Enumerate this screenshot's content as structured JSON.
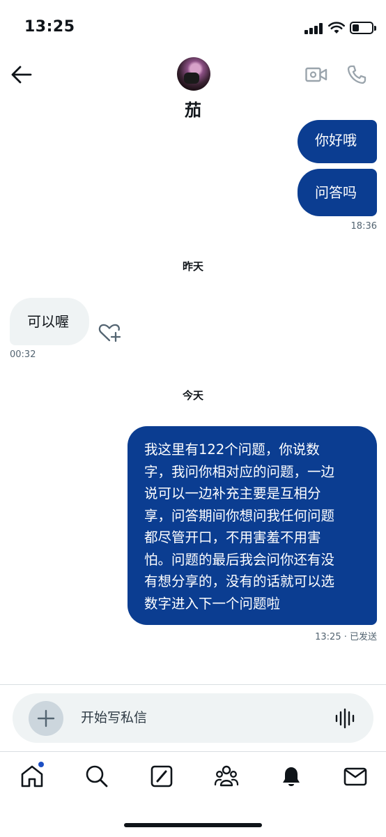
{
  "status_bar": {
    "time": "13:25"
  },
  "header": {
    "contact_name": "茄"
  },
  "messages": [
    {
      "direction": "sent",
      "text": "你好哦"
    },
    {
      "direction": "sent",
      "text": "问答吗",
      "timestamp": "18:36"
    },
    {
      "separator": "昨天"
    },
    {
      "direction": "received",
      "text": "可以喔",
      "timestamp": "00:32"
    },
    {
      "separator": "今天"
    },
    {
      "direction": "sent",
      "lines": [
        "我这里有122个问题，你说数",
        "字，我问你相对应的问题，一边",
        "说可以一边补充主要是互相分",
        "享，问答期间你想问我任何问题",
        "都尽管开口，不用害羞不用害",
        "怕。问题的最后我会问你还有没",
        "有想分享的，没有的话就可以选",
        "数字进入下一个问题啦"
      ],
      "timestamp": "13:25 · 已发送"
    }
  ],
  "composer": {
    "placeholder": "开始写私信"
  },
  "icons": {
    "back": "back-arrow-icon",
    "video": "video-camera-icon",
    "phone": "phone-icon",
    "react": "heart-plus-icon",
    "add": "plus-icon",
    "voice": "voice-wave-icon",
    "nav": [
      "home-icon",
      "search-icon",
      "compose-icon",
      "communities-icon",
      "notifications-icon",
      "messages-icon"
    ]
  },
  "colors": {
    "sent_bubble": "#0b3d91",
    "received_bubble": "#eff3f4",
    "notification_dot": "#1d4fc4"
  }
}
